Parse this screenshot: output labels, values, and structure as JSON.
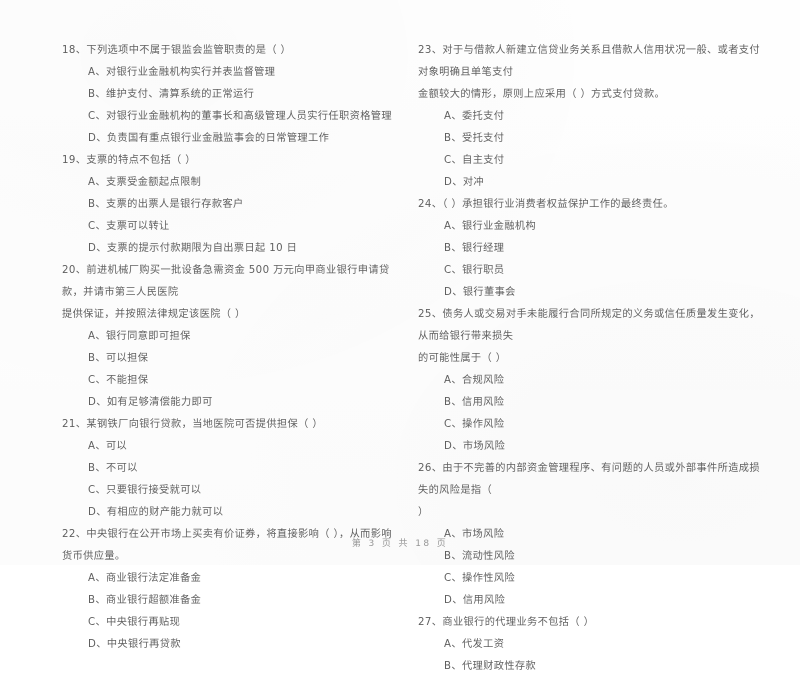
{
  "document": {
    "type": "scanned-exam-paper",
    "language": "zh-CN",
    "subject_hint": "银行业法律法规与综合能力 单项选择题"
  },
  "footer": {
    "page_label": "第 3 页 共 18 页"
  },
  "left_column": [
    {
      "number": "18、",
      "stem": "18、下列选项中不属于银监会监管职责的是（    ）",
      "options": [
        "A、对银行业金融机构实行并表监督管理",
        "B、维护支付、清算系统的正常运行",
        "C、对银行业金融机构的董事长和高级管理人员实行任职资格管理",
        "D、负责国有重点银行业金融监事会的日常管理工作"
      ]
    },
    {
      "number": "19、",
      "stem": "19、支票的特点不包括（    ）",
      "options": [
        "A、支票受金额起点限制",
        "B、支票的出票人是银行存款客户",
        "C、支票可以转让",
        "D、支票的提示付款期限为自出票日起 10 日"
      ]
    },
    {
      "number": "20、",
      "stem": "20、前进机械厂购买一批设备急需资金 500 万元向甲商业银行申请贷款，并请市第三人民医院",
      "stem_cont": "提供保证，并按照法律规定该医院（    ）",
      "options": [
        "A、银行同意即可担保",
        "B、可以担保",
        "C、不能担保",
        "D、如有足够清偿能力即可"
      ]
    },
    {
      "number": "21、",
      "stem": "21、某钢铁厂向银行贷款，当地医院可否提供担保（    ）",
      "options": [
        "A、可以",
        "B、不可以",
        "C、只要银行接受就可以",
        "D、有相应的财产能力就可以"
      ]
    },
    {
      "number": "22、",
      "stem": "22、中央银行在公开市场上买卖有价证券，将直接影响（    ），从而影响货币供应量。",
      "options": [
        "A、商业银行法定准备金",
        "B、商业银行超额准备金",
        "C、中央银行再贴现",
        "D、中央银行再贷款"
      ]
    }
  ],
  "right_column": [
    {
      "number": "23、",
      "stem": "23、对于与借款人新建立信贷业务关系且借款人信用状况一般、或者支付对象明确且单笔支付",
      "stem_cont": "金额较大的情形，原则上应采用（    ）方式支付贷款。",
      "options": [
        "A、委托支付",
        "B、受托支付",
        "C、自主支付",
        "D、对冲"
      ]
    },
    {
      "number": "24、",
      "stem": "24、（    ）承担银行业消费者权益保护工作的最终责任。",
      "options": [
        "A、银行业金融机构",
        "B、银行经理",
        "C、银行职员",
        "D、银行董事会"
      ]
    },
    {
      "number": "25、",
      "stem": "25、债务人或交易对手未能履行合同所规定的义务或信任质量发生变化，从而给银行带来损失",
      "stem_cont": "的可能性属于（    ）",
      "options": [
        "A、合规风险",
        "B、信用风险",
        "C、操作风险",
        "D、市场风险"
      ]
    },
    {
      "number": "26、",
      "stem": "26、由于不完善的内部资金管理程序、有问题的人员或外部事件所造成损失的风险是指（",
      "stem_cont": "）",
      "options": [
        "A、市场风险",
        "B、流动性风险",
        "C、操作性风险",
        "D、信用风险"
      ]
    },
    {
      "number": "27、",
      "stem": "27、商业银行的代理业务不包括（    ）",
      "options": [
        "A、代发工资",
        "B、代理财政性存款"
      ]
    }
  ]
}
